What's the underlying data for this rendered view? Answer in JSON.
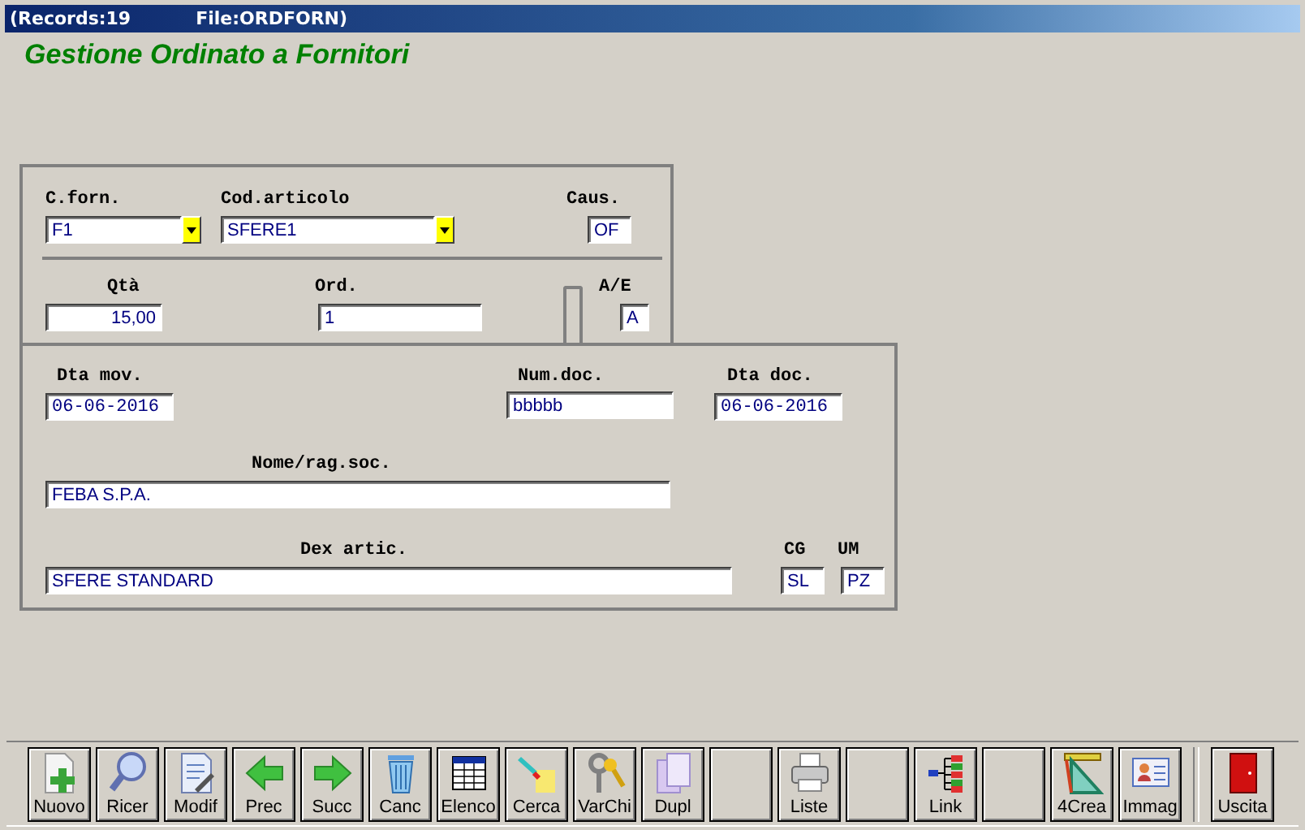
{
  "title_bar": {
    "records": "(Records:19",
    "file": "File:ORDFORN)"
  },
  "heading": "Gestione Ordinato a Fornitori",
  "top_panel": {
    "fields": [
      {
        "label": "C.forn.",
        "value": "F1",
        "kind": "combo"
      },
      {
        "label": "Cod.articolo",
        "value": "SFERE1",
        "kind": "combo"
      },
      {
        "label": "Caus.",
        "value": "OF",
        "kind": "text"
      },
      {
        "label": "Qtà",
        "value": "15,00",
        "kind": "number"
      },
      {
        "label": "Ord.",
        "value": "1",
        "kind": "text"
      },
      {
        "label": "A/E",
        "value": "A",
        "kind": "text"
      }
    ]
  },
  "bottom_panel": {
    "fields": [
      {
        "label": "Dta mov.",
        "value": "06-06-2016",
        "kind": "date"
      },
      {
        "label": "Num.doc.",
        "value": "bbbbb",
        "kind": "text"
      },
      {
        "label": "Dta doc.",
        "value": "06-06-2016",
        "kind": "date"
      },
      {
        "label": "Nome/rag.soc.",
        "value": "FEBA S.P.A.",
        "kind": "text"
      },
      {
        "label": "Dex artic.",
        "value": "SFERE STANDARD",
        "kind": "text"
      },
      {
        "label": "CG",
        "value": "SL",
        "kind": "text"
      },
      {
        "label": "UM",
        "value": "PZ",
        "kind": "text"
      }
    ]
  },
  "toolbar": [
    {
      "kind": "new",
      "label": "Nuovo"
    },
    {
      "kind": "search",
      "label": "Ricer"
    },
    {
      "kind": "edit",
      "label": "Modif"
    },
    {
      "kind": "prev",
      "label": "Prec"
    },
    {
      "kind": "next",
      "label": "Succ"
    },
    {
      "kind": "delete",
      "label": "Canc"
    },
    {
      "kind": "table",
      "label": "Elenco"
    },
    {
      "kind": "find",
      "label": "Cerca"
    },
    {
      "kind": "keys",
      "label": "VarChi"
    },
    {
      "kind": "duplicate",
      "label": "Dupl"
    },
    {
      "kind": "blank"
    },
    {
      "kind": "print",
      "label": "Liste"
    },
    {
      "kind": "blank"
    },
    {
      "kind": "link",
      "label": "Link"
    },
    {
      "kind": "blank"
    },
    {
      "kind": "create",
      "label": "4Crea"
    },
    {
      "kind": "image",
      "label": "Immag"
    },
    {
      "kind": "exit",
      "label": "Uscita"
    }
  ]
}
